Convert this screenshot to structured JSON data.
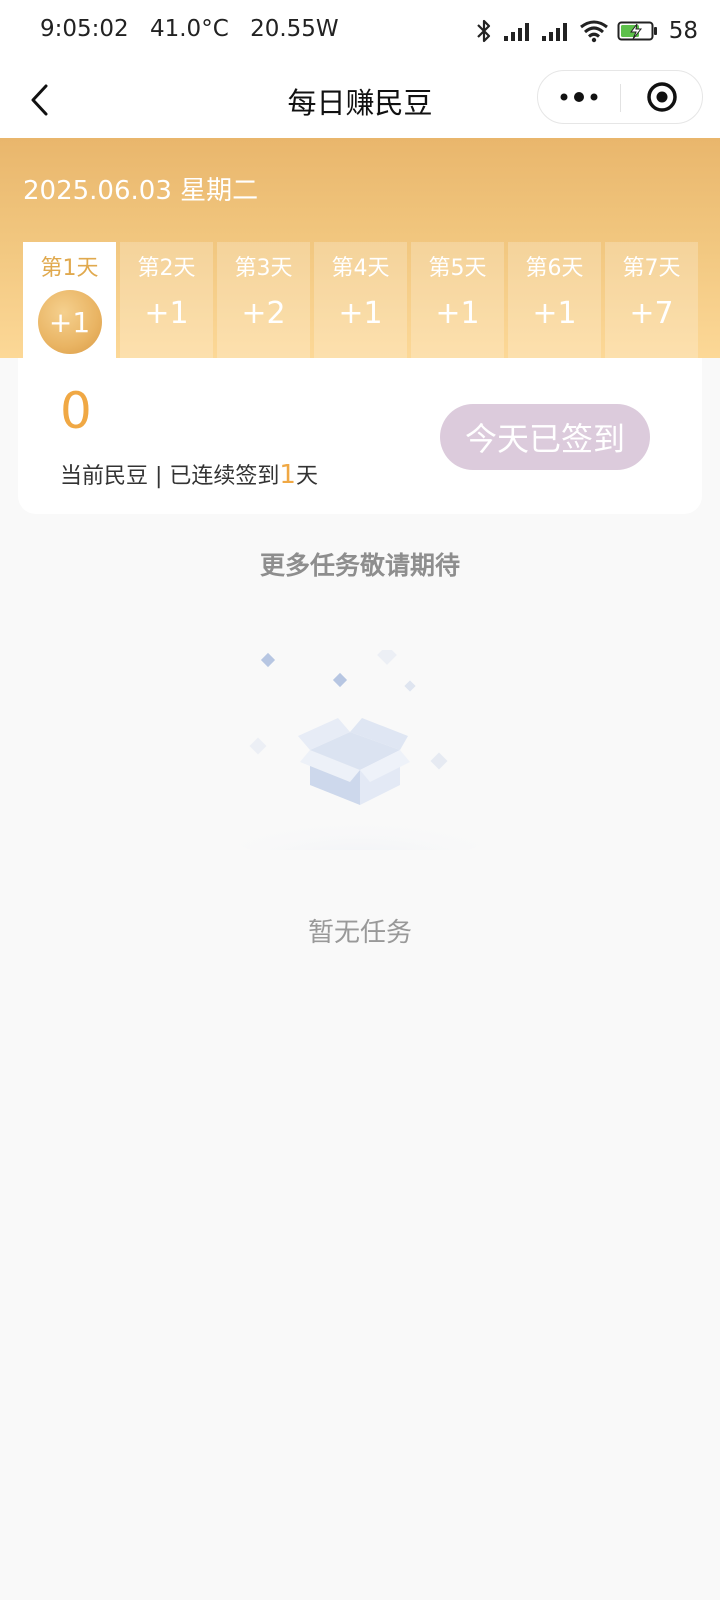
{
  "status_bar": {
    "time": "9:05:02",
    "temperature": "41.0°C",
    "power": "20.55W",
    "battery": "58"
  },
  "nav": {
    "title": "每日赚民豆"
  },
  "header": {
    "date": "2025.06.03 星期二",
    "days": [
      {
        "label": "第1天",
        "reward": "+1",
        "active": true
      },
      {
        "label": "第2天",
        "reward": "+1",
        "active": false
      },
      {
        "label": "第3天",
        "reward": "+2",
        "active": false
      },
      {
        "label": "第4天",
        "reward": "+1",
        "active": false
      },
      {
        "label": "第5天",
        "reward": "+1",
        "active": false
      },
      {
        "label": "第6天",
        "reward": "+1",
        "active": false
      },
      {
        "label": "第7天",
        "reward": "+7",
        "active": false
      }
    ]
  },
  "sign_card": {
    "bean_count": "0",
    "current_label": "当前民豆 | 已连续签到",
    "streak_days": "1",
    "streak_unit": "天",
    "signed_button": "今天已签到"
  },
  "tasks": {
    "more_title": "更多任务敬请期待",
    "empty_text": "暂无任务"
  },
  "colors": {
    "accent": "#f0a844",
    "signed_button": "#dccbdc",
    "header_gradient_top": "#e9b66c",
    "header_gradient_bottom": "#fcd897"
  }
}
